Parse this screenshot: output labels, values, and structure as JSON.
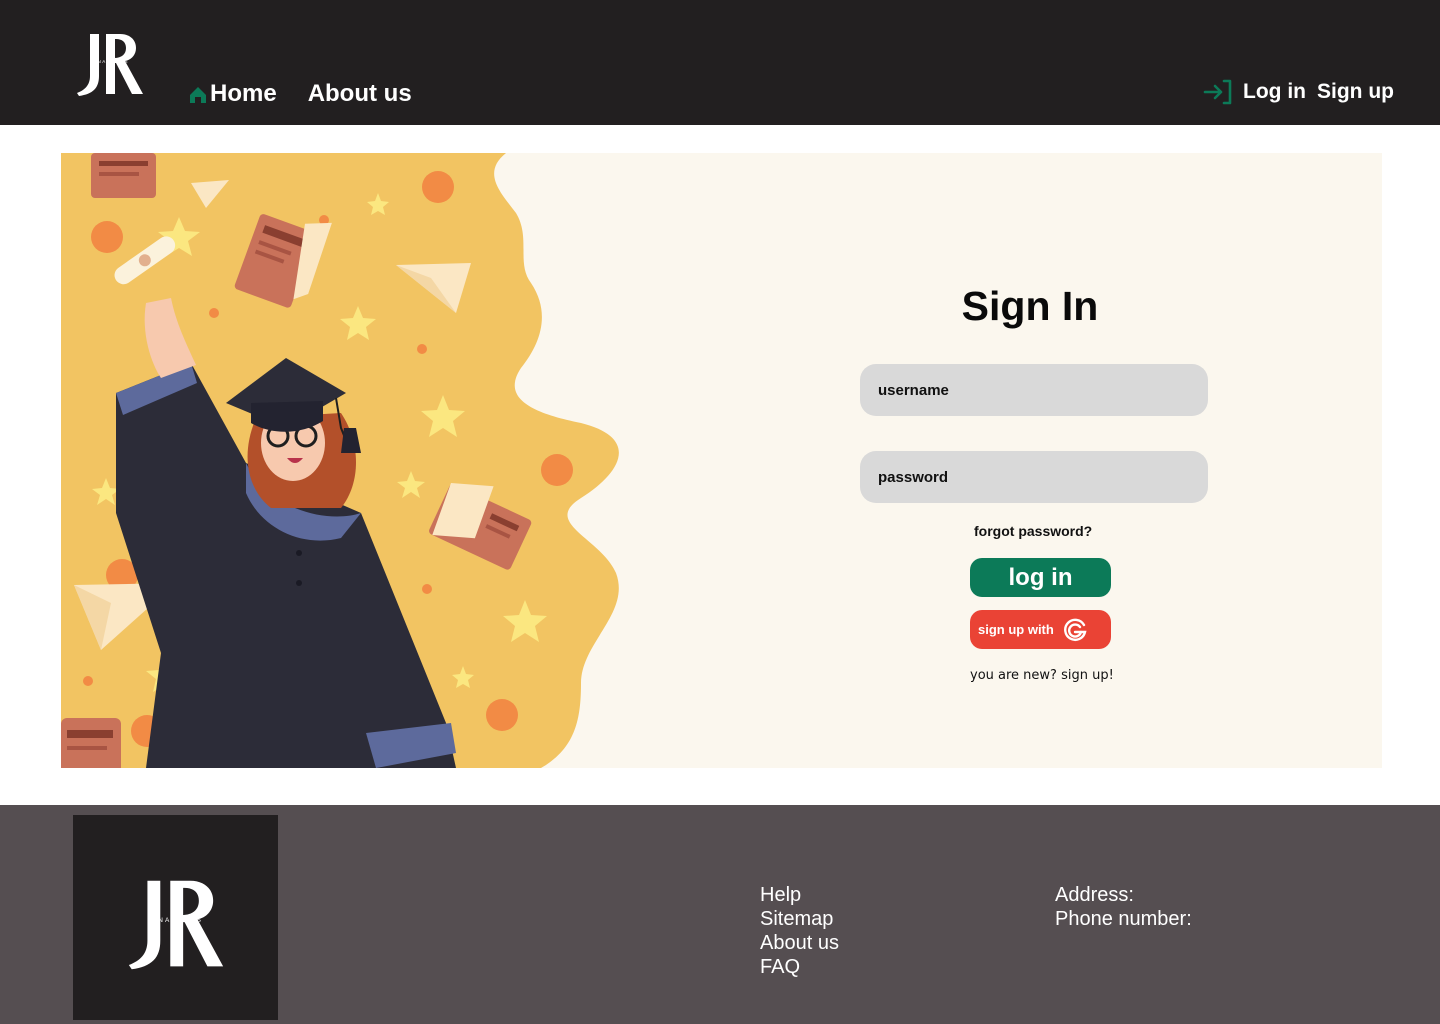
{
  "header": {
    "logo_text": "JR",
    "logo_subtext": "JINARATES",
    "nav": [
      {
        "label": "Home",
        "icon": "home-icon"
      },
      {
        "label": "About us"
      }
    ],
    "auth": {
      "login_icon": "login-icon",
      "login_label": "Log in",
      "signup_label": "Sign up"
    }
  },
  "signin": {
    "title": "Sign In",
    "username_placeholder": "username",
    "password_placeholder": "password",
    "forgot_label": "forgot password?",
    "login_button": "log in",
    "google_button": "sign up with",
    "google_icon": "google-icon",
    "new_user_link": "you are new? sign up!"
  },
  "footer": {
    "logo_text": "JR",
    "logo_subtext": "JINARATES",
    "links": [
      "Help",
      "Sitemap",
      "About us",
      "FAQ"
    ],
    "contact": [
      "Address:",
      "Phone number:"
    ]
  },
  "colors": {
    "header_bg": "#221f20",
    "accent_green": "#0c7a58",
    "google_red": "#ea4335",
    "panel_bg": "#fbf7ee",
    "illustration_yellow": "#f2c462",
    "footer_bg": "#554e51"
  }
}
